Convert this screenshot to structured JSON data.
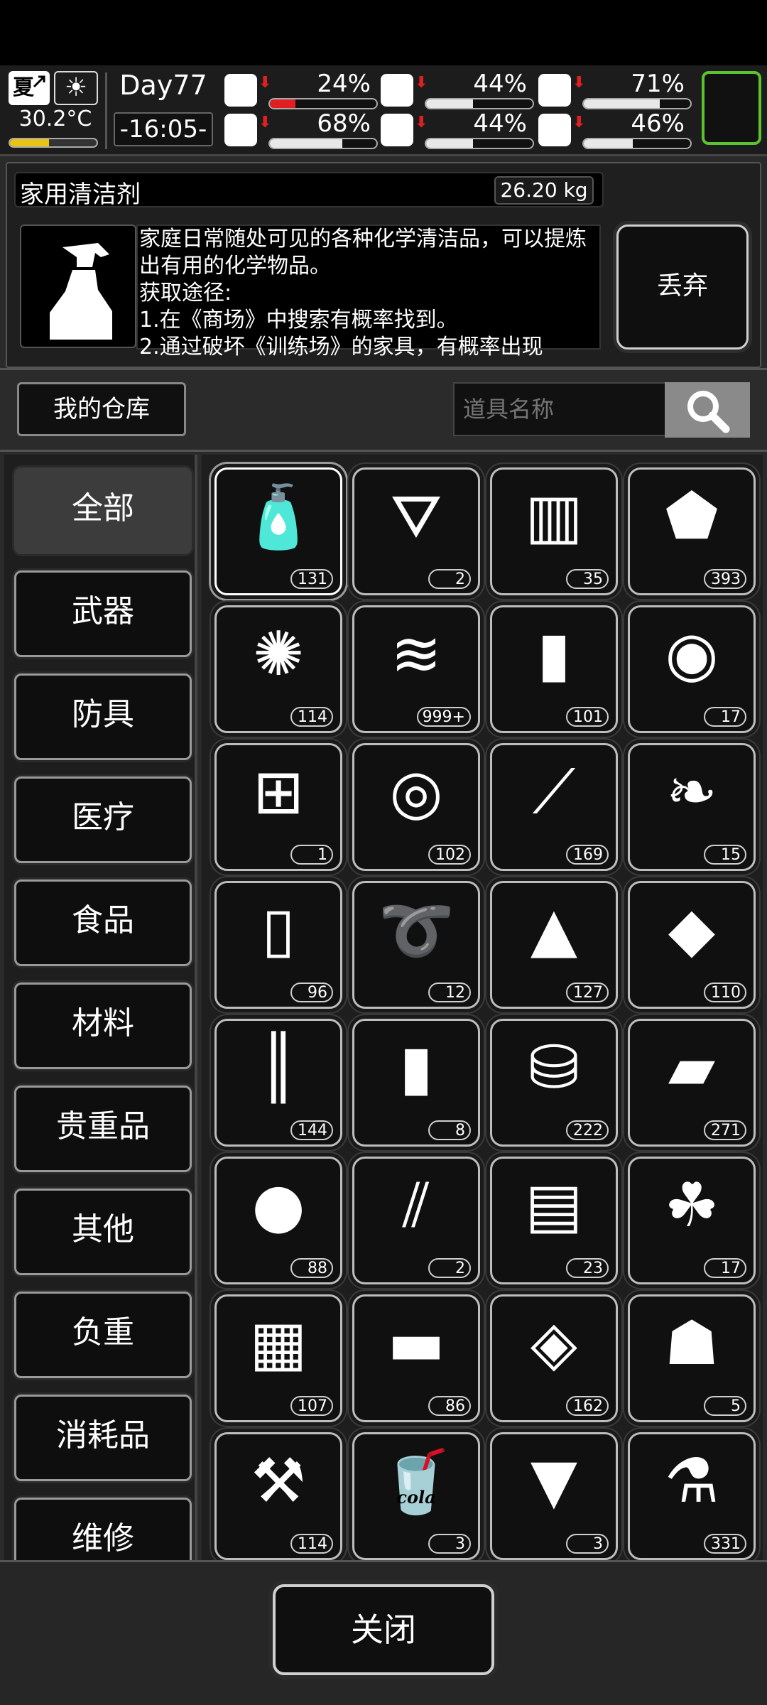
{
  "hud": {
    "season": "夏",
    "weather_icon": "sun-icon",
    "temperature": "30.2°C",
    "temperature_level": 0.45,
    "day": "Day77",
    "time": "-16:05-",
    "stats": [
      {
        "name": "health",
        "icon": "medkit-icon",
        "value": "24%",
        "level": 0.24,
        "trend": "down",
        "bar_color": "#e02020"
      },
      {
        "name": "hunger",
        "icon": "stomach-icon",
        "value": "44%",
        "level": 0.44,
        "trend": "down",
        "bar_color": "#e8e8e8"
      },
      {
        "name": "oxygen",
        "icon": "mask-icon",
        "value": "71%",
        "level": 0.71,
        "trend": "down",
        "bar_color": "#e8e8e8"
      },
      {
        "name": "stamina",
        "icon": "boot-icon",
        "value": "68%",
        "level": 0.68,
        "trend": "down",
        "bar_color": "#e8e8e8"
      },
      {
        "name": "thirst",
        "icon": "water-drop-icon",
        "value": "44%",
        "level": 0.44,
        "trend": "down",
        "bar_color": "#e8e8e8"
      },
      {
        "name": "mood",
        "icon": "heart-icon",
        "value": "46%",
        "level": 0.46,
        "trend": "down",
        "bar_color": "#e8e8e8"
      }
    ]
  },
  "detail": {
    "title": "家用清洁剂",
    "weight": "26.20 kg",
    "description": "家庭日常随处可见的各种化学清洁品，可以提炼出有用的化学物品。\n获取途径:\n1.在《商场》中搜索有概率找到。\n2.通过破坏《训练场》的家具，有概率出现",
    "discard_label": "丢弃"
  },
  "warehouse": {
    "label": "我的仓库",
    "search_placeholder": "道具名称"
  },
  "categories": [
    "全部",
    "武器",
    "防具",
    "医疗",
    "食品",
    "材料",
    "贵重品",
    "其他",
    "负重",
    "消耗品",
    "维修"
  ],
  "items": [
    {
      "icon": "spray-bottle-icon",
      "count": "131"
    },
    {
      "icon": "torn-cloth-icon",
      "count": "2"
    },
    {
      "icon": "towel-icon",
      "count": "35"
    },
    {
      "icon": "rock-icon",
      "count": "393"
    },
    {
      "icon": "fiber-ball-icon",
      "count": "114"
    },
    {
      "icon": "folded-cloth-icon",
      "count": "999+"
    },
    {
      "icon": "plastic-bottle-icon",
      "count": "101"
    },
    {
      "icon": "seeds-icon",
      "count": "17"
    },
    {
      "icon": "mesh-filter-icon",
      "count": "1"
    },
    {
      "icon": "tape-roll-icon",
      "count": "102"
    },
    {
      "icon": "lockpick-icon",
      "count": "169"
    },
    {
      "icon": "sunflower-seeds-icon",
      "count": "15"
    },
    {
      "icon": "metal-cans-icon",
      "count": "96"
    },
    {
      "icon": "rope-icon",
      "count": "12"
    },
    {
      "icon": "bullet-icon",
      "count": "127"
    },
    {
      "icon": "bullet-tips-icon",
      "count": "110"
    },
    {
      "icon": "pipes-icon",
      "count": "144"
    },
    {
      "icon": "water-bottle-icon",
      "count": "8"
    },
    {
      "icon": "fuel-barrel-icon",
      "count": "222"
    },
    {
      "icon": "leather-sheet-icon",
      "count": "271"
    },
    {
      "icon": "cotton-balls-icon",
      "count": "88"
    },
    {
      "icon": "ampoules-icon",
      "count": "2"
    },
    {
      "icon": "bricks-icon",
      "count": "23"
    },
    {
      "icon": "soil-sprout-icon",
      "count": "17"
    },
    {
      "icon": "wood-planks-icon",
      "count": "107"
    },
    {
      "icon": "metal-scrap-icon",
      "count": "86"
    },
    {
      "icon": "ore-chunk-icon",
      "count": "162"
    },
    {
      "icon": "sack-icon",
      "count": "5"
    },
    {
      "icon": "scrap-parts-icon",
      "count": "114"
    },
    {
      "icon": "cola-cup-icon",
      "count": "3",
      "label": "cola"
    },
    {
      "icon": "popcorn-icon",
      "count": "3"
    },
    {
      "icon": "beaker-icon",
      "count": "331"
    }
  ],
  "close_label": "关闭",
  "colors": {
    "accent_green": "#5cc22e",
    "warning_red": "#e02020",
    "temperature_yellow": "#e8c414"
  }
}
